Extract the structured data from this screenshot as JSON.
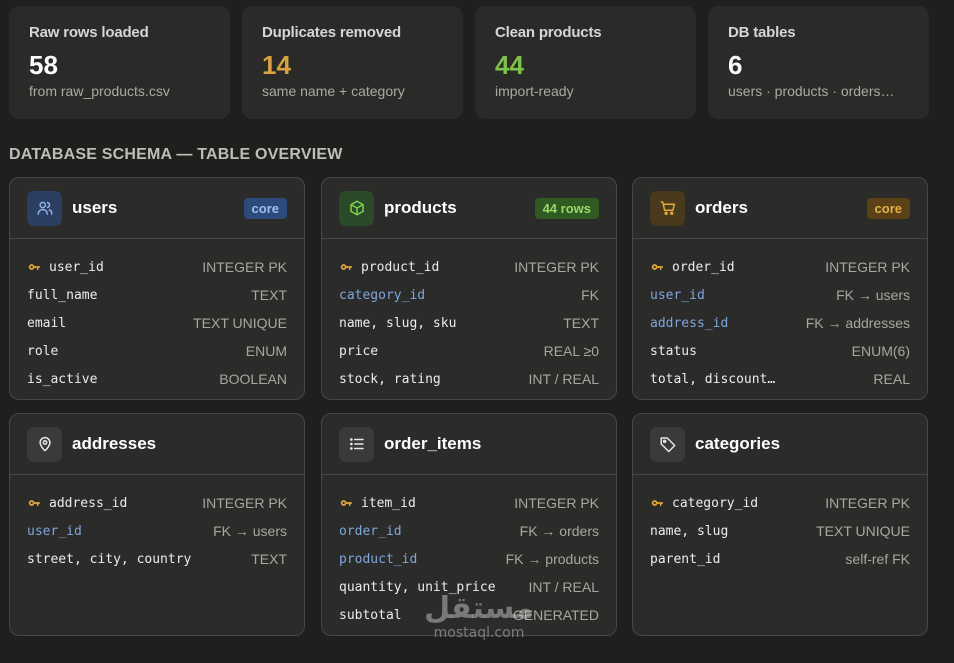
{
  "stats": [
    {
      "label": "Raw rows loaded",
      "value": "58",
      "sub": "from raw_products.csv",
      "color": "#ffffff"
    },
    {
      "label": "Duplicates removed",
      "value": "14",
      "sub": "same name + category",
      "color": "#d9a23a"
    },
    {
      "label": "Clean products",
      "value": "44",
      "sub": "import-ready",
      "color": "#7fc24a"
    },
    {
      "label": "DB tables",
      "value": "6",
      "sub": "users · products · orders…",
      "color": "#ffffff"
    }
  ],
  "section_title": "DATABASE SCHEMA — TABLE OVERVIEW",
  "tables": [
    {
      "name": "users",
      "icon": "users-icon",
      "badge": "core",
      "columns": [
        {
          "name": "user_id",
          "type": "INTEGER PK",
          "pk": true
        },
        {
          "name": "full_name",
          "type": "TEXT"
        },
        {
          "name": "email",
          "type": "TEXT UNIQUE"
        },
        {
          "name": "role",
          "type": "ENUM"
        },
        {
          "name": "is_active",
          "type": "BOOLEAN"
        }
      ]
    },
    {
      "name": "products",
      "icon": "cube-icon",
      "badge": "44 rows",
      "columns": [
        {
          "name": "product_id",
          "type": "INTEGER PK",
          "pk": true
        },
        {
          "name": "category_id",
          "type": "FK",
          "fk": true
        },
        {
          "name": "name, slug, sku",
          "type": "TEXT"
        },
        {
          "name": "price",
          "type": "REAL ≥0"
        },
        {
          "name": "stock, rating",
          "type": "INT / REAL"
        }
      ]
    },
    {
      "name": "orders",
      "icon": "cart-icon",
      "badge": "core",
      "columns": [
        {
          "name": "order_id",
          "type": "INTEGER PK",
          "pk": true
        },
        {
          "name": "user_id",
          "type": "FK → users",
          "fk": true
        },
        {
          "name": "address_id",
          "type": "FK → addresses",
          "fk": true
        },
        {
          "name": "status",
          "type": "ENUM(6)"
        },
        {
          "name": "total, discount…",
          "type": "REAL"
        }
      ]
    },
    {
      "name": "addresses",
      "icon": "map-pin-icon",
      "columns": [
        {
          "name": "address_id",
          "type": "INTEGER PK",
          "pk": true
        },
        {
          "name": "user_id",
          "type": "FK → users",
          "fk": true
        },
        {
          "name": "street, city, country",
          "type": "TEXT"
        }
      ]
    },
    {
      "name": "order_items",
      "icon": "list-icon",
      "columns": [
        {
          "name": "item_id",
          "type": "INTEGER PK",
          "pk": true
        },
        {
          "name": "order_id",
          "type": "FK → orders",
          "fk": true
        },
        {
          "name": "product_id",
          "type": "FK → products",
          "fk": true
        },
        {
          "name": "quantity, unit_price",
          "type": "INT / REAL"
        },
        {
          "name": "subtotal",
          "type": "GENERATED"
        }
      ]
    },
    {
      "name": "categories",
      "icon": "tag-icon",
      "columns": [
        {
          "name": "category_id",
          "type": "INTEGER PK",
          "pk": true
        },
        {
          "name": "name, slug",
          "type": "TEXT UNIQUE"
        },
        {
          "name": "parent_id",
          "type": "self-ref FK"
        }
      ]
    }
  ],
  "watermark": {
    "arabic": "مستقل",
    "latin": "mostaql.com"
  }
}
